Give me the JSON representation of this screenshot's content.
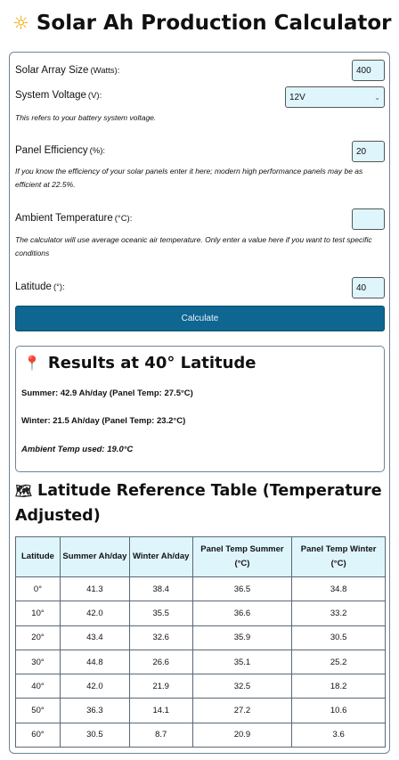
{
  "header": {
    "icon": "sun-icon",
    "title": "Solar Ah Production Calculator"
  },
  "form": {
    "array_size": {
      "label": "Solar Array Size",
      "unit": "(Watts):",
      "value": "400"
    },
    "voltage": {
      "label": "System Voltage",
      "unit": "(V):",
      "value": "12V",
      "note": "This refers to your battery system voltage."
    },
    "efficiency": {
      "label": "Panel Efficiency",
      "unit": "(%):",
      "value": "20",
      "note": "If you know the efficiency of your solar panels enter it here; modern high performance panels may be as efficient at 22.5%."
    },
    "ambient": {
      "label": "Ambient Temperature",
      "unit": "(°C):",
      "value": "",
      "note": "The calculator will use average oceanic air temperature. Only enter a value here if you want to test specific conditions"
    },
    "latitude": {
      "label": "Latitude",
      "unit": "(°):",
      "value": "40"
    },
    "calculate_label": "Calculate"
  },
  "results": {
    "icon": "pin-icon",
    "title": "Results at 40° Latitude",
    "summer": "Summer: 42.9 Ah/day (Panel Temp: 27.5°C)",
    "winter": "Winter: 21.5 Ah/day (Panel Temp: 23.2°C)",
    "ambient": "Ambient Temp used: 19.0°C"
  },
  "reference": {
    "icon": "globe-icon",
    "title": "Latitude Reference Table (Temperature Adjusted)",
    "headers": [
      "Latitude",
      "Summer Ah/day",
      "Winter Ah/day",
      "Panel Temp Summer (°C)",
      "Panel Temp Winter (°C)"
    ],
    "rows": [
      [
        "0°",
        "41.3",
        "38.4",
        "36.5",
        "34.8"
      ],
      [
        "10°",
        "42.0",
        "35.5",
        "36.6",
        "33.2"
      ],
      [
        "20°",
        "43.4",
        "32.6",
        "35.9",
        "30.5"
      ],
      [
        "30°",
        "44.8",
        "26.6",
        "35.1",
        "25.2"
      ],
      [
        "40°",
        "42.0",
        "21.9",
        "32.5",
        "18.2"
      ],
      [
        "50°",
        "36.3",
        "14.1",
        "27.2",
        "10.6"
      ],
      [
        "60°",
        "30.5",
        "8.7",
        "20.9",
        "3.6"
      ]
    ]
  }
}
